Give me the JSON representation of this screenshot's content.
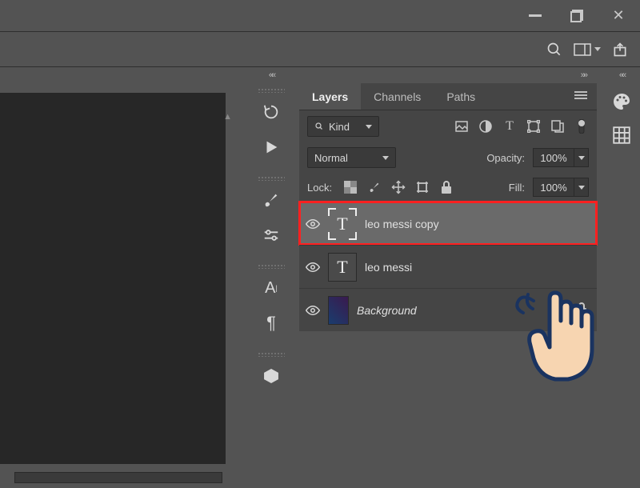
{
  "window_controls": {
    "minimize": "minimize",
    "restore": "restore",
    "close": "close"
  },
  "options": {
    "search": "search",
    "screen_mode": "screen-mode",
    "share": "share"
  },
  "panel": {
    "tabs": [
      "Layers",
      "Channels",
      "Paths"
    ],
    "active_tab": 0,
    "filter": {
      "kind_label": "Kind"
    },
    "blend_mode": "Normal",
    "opacity_label": "Opacity:",
    "opacity_value": "100%",
    "lock_label": "Lock:",
    "fill_label": "Fill:",
    "fill_value": "100%",
    "layers": [
      {
        "name": "leo messi  copy",
        "type": "text",
        "visible": true,
        "selected": true
      },
      {
        "name": "leo messi",
        "type": "text",
        "visible": true,
        "selected": false
      },
      {
        "name": "Background",
        "type": "image",
        "visible": true,
        "selected": false,
        "locked": true
      }
    ]
  }
}
